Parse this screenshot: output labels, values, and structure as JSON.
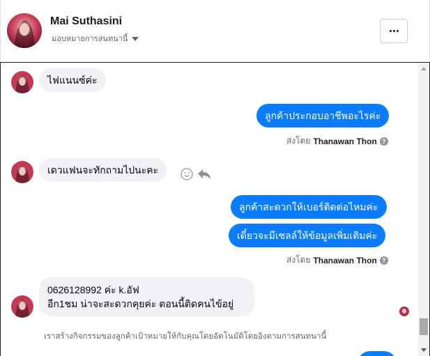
{
  "header": {
    "contact_name": "Mai Suthasini",
    "assign_label": "มอบหมายการสนทนานี้",
    "more_label": "...",
    "more_icon": "more-dots-icon",
    "caret_icon": "caret-down-icon"
  },
  "messages": [
    {
      "direction": "incoming",
      "text": "ไฟแนนซ์ค่ะ"
    },
    {
      "direction": "outgoing",
      "text": "ลูกค้าประกอบอาชีพอะไรค่ะ"
    },
    {
      "direction": "incoming",
      "text": "เดวแฟนจะทักถามไปนะคะ"
    },
    {
      "direction": "outgoing",
      "text": "ลูกค้าสะดวกให้เบอร์ติดต่อไหมค่ะ"
    },
    {
      "direction": "outgoing",
      "text": "เดี๋ยวจะมีเซลล์ให้ข้อมูลเพิ่มเติมค่ะ"
    },
    {
      "direction": "incoming",
      "line1": "0626128992 ค่ะ k.อัฟ",
      "line2": "อีก1ชม น่าจะสะดวกคุยค่ะ ตอนนี้ติดคนไข้อยู่"
    }
  ],
  "sent_by": {
    "prefix": "ส่งโดย",
    "agent": "Thanawan Thon",
    "help": "?"
  },
  "system_note": "เราสร้างกิจกรรมของลูกค้าเป้าหมายให้กับคุณโดยอัตโนมัติโดยอิงตามการสนทนานี้",
  "colors": {
    "outgoing_bubble": "#0a7cff",
    "incoming_bubble": "#f0f2f5",
    "secondary_text": "#606770"
  }
}
